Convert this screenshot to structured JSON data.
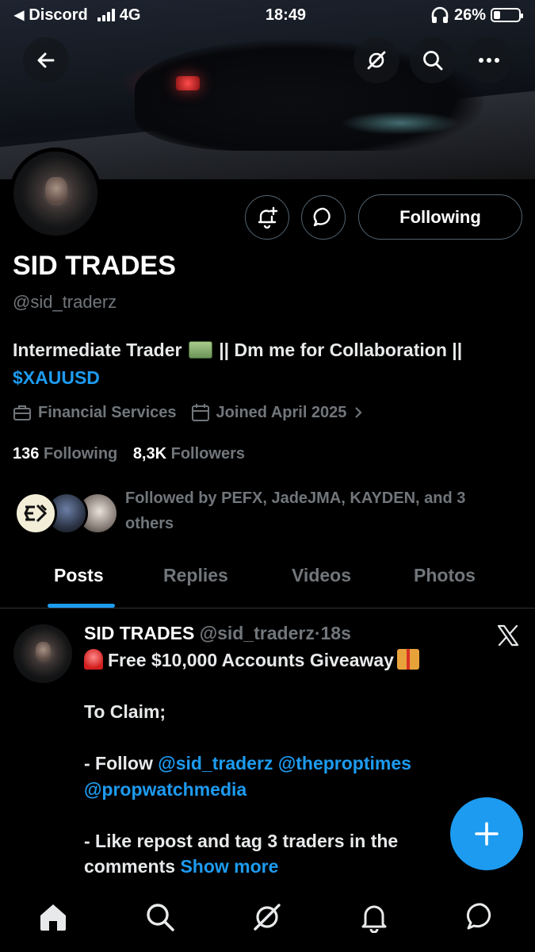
{
  "status_bar": {
    "back_app": "Discord",
    "network": "4G",
    "time": "18:49",
    "battery": "26%",
    "battery_level": 0.26
  },
  "banner": {
    "buttons": [
      "back-arrow-icon",
      "grok-icon",
      "search-icon",
      "more-icon"
    ]
  },
  "profile": {
    "name": "SID TRADES",
    "handle": "@sid_traderz",
    "bio_part1": "Intermediate Trader",
    "bio_part2": "|| Dm me for Collaboration ||",
    "bio_link": "$XAUUSD",
    "category": "Financial Services",
    "joined": "Joined April 2025",
    "following_count": "136",
    "following_label": "Following",
    "followers_count": "8,3K",
    "followers_label": "Followers",
    "followed_by": "Followed by PEFX, JadeJMA, KAYDEN, and 3 others"
  },
  "actions": {
    "following_button": "Following"
  },
  "tabs": [
    {
      "label": "Posts",
      "active": true
    },
    {
      "label": "Replies",
      "active": false
    },
    {
      "label": "Videos",
      "active": false
    },
    {
      "label": "Photos",
      "active": false
    }
  ],
  "post": {
    "author": "SID TRADES",
    "handle": "@sid_traderz",
    "separator": "·",
    "time": "18s",
    "line1": "Free $10,000 Accounts Giveaway",
    "line2": "To Claim;",
    "line3_prefix": "- Follow",
    "mention1": "@sid_traderz",
    "mention2": "@theproptimes",
    "mention3": "@propwatchmedia",
    "line4": "- Like repost and tag 3 traders in the comments",
    "show_more": "Show more"
  },
  "colors": {
    "accent": "#1d9bf0",
    "muted": "#71767b",
    "background": "#000000",
    "border": "#2f3336"
  }
}
